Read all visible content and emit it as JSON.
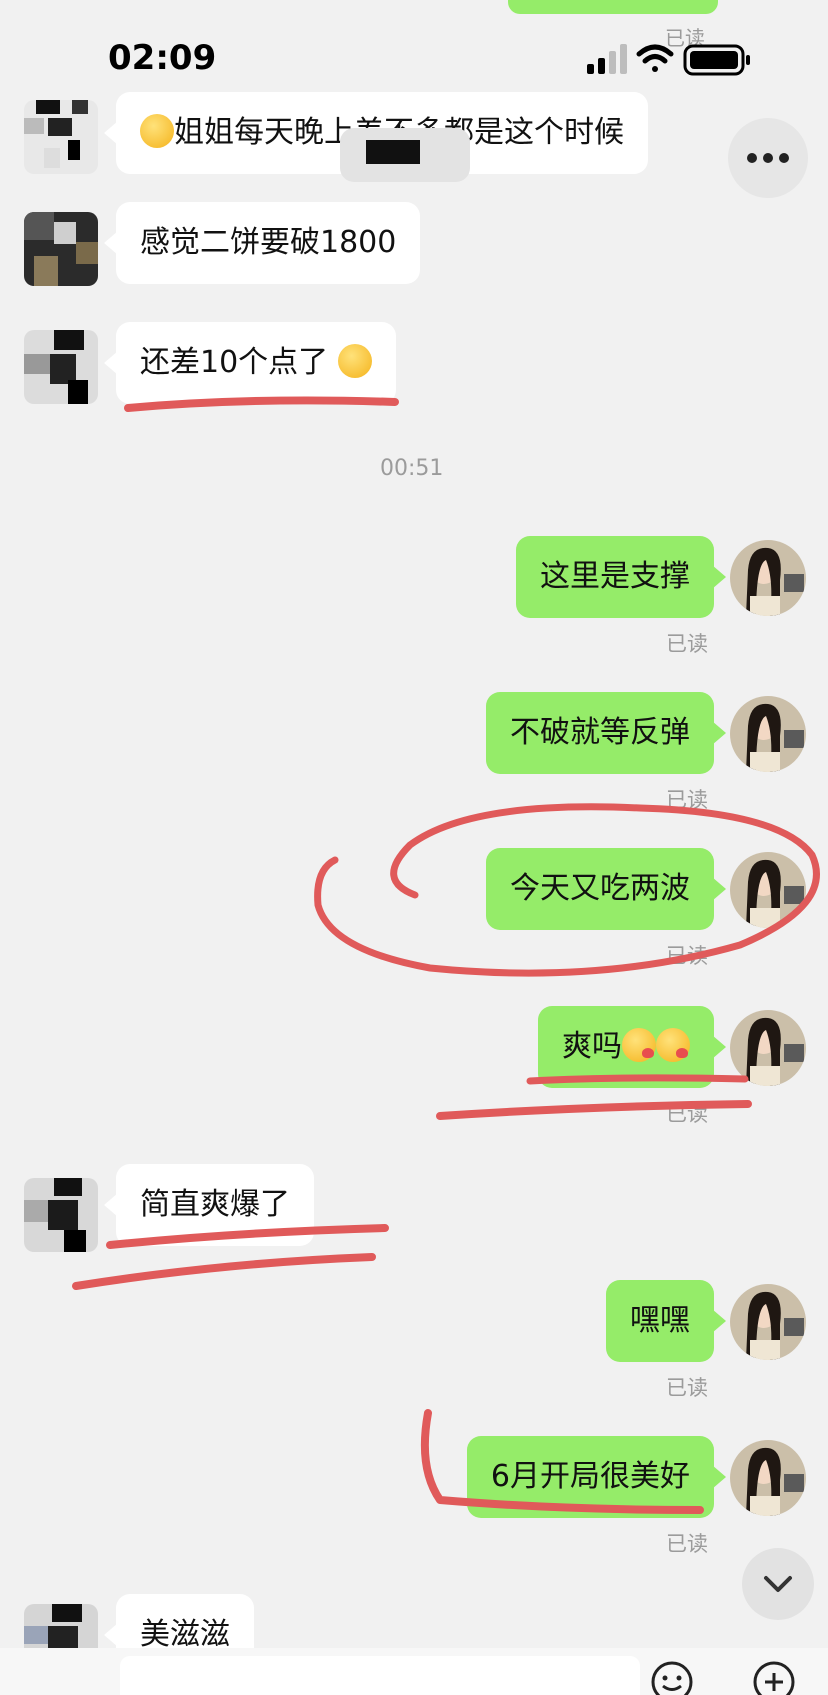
{
  "status_bar": {
    "time": "02:09"
  },
  "top_read_label": "已读",
  "messages_in": [
    {
      "text": "姐姐每天晚上差不多都是这个时候",
      "emoji_prefix": true
    },
    {
      "text": "感觉二饼要破1800"
    },
    {
      "text": "还差10个点了",
      "emoji_suffix": true
    },
    {
      "text": "简直爽爆了"
    },
    {
      "text": "美滋滋"
    }
  ],
  "timestamp": "00:51",
  "messages_out": [
    {
      "text": "这里是支撑",
      "read": "已读"
    },
    {
      "text": "不破就等反弹",
      "read": "已读"
    },
    {
      "text": "今天又吃两波",
      "read": "已读"
    },
    {
      "text": "爽吗",
      "read": "已读"
    },
    {
      "text": "嘿嘿",
      "read": "已读"
    },
    {
      "text": "6月开局很美好",
      "read": "已读"
    }
  ],
  "colors": {
    "bubble_out": "#95ec69",
    "bubble_in": "#ffffff",
    "annotation": "#e05a5a",
    "background": "#f1f1f1"
  },
  "icons": [
    "more-icon",
    "chevron-down-icon",
    "emoji-icon",
    "plus-icon",
    "signal-icon",
    "wifi-icon",
    "battery-icon"
  ]
}
